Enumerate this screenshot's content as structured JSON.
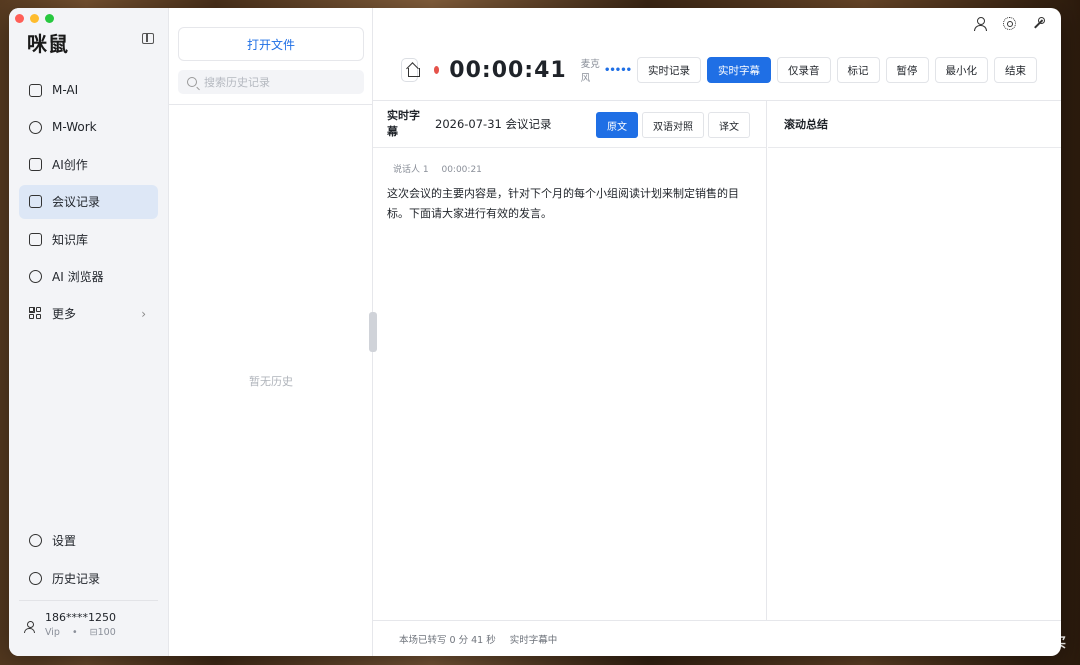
{
  "app": {
    "logo": "咪鼠"
  },
  "sidebar": {
    "items": [
      {
        "label": "M-AI",
        "icon": "chat-sparkle-icon"
      },
      {
        "label": "M-Work",
        "icon": "leaf-icon"
      },
      {
        "label": "AI创作",
        "icon": "image-icon"
      },
      {
        "label": "会议记录",
        "icon": "edit-note-icon",
        "active": true
      },
      {
        "label": "知识库",
        "icon": "book-icon"
      },
      {
        "label": "AI 浏览器",
        "icon": "compass-icon"
      },
      {
        "label": "更多",
        "icon": "grid-icon",
        "chevron": "›"
      }
    ],
    "bottom_items": [
      {
        "label": "设置",
        "icon": "gear-icon"
      },
      {
        "label": "历史记录",
        "icon": "clock-icon"
      }
    ],
    "user": {
      "phone": "186****1250",
      "tier": "Vip",
      "separator": "•",
      "credits": "⊟100"
    }
  },
  "history": {
    "open_file_label": "打开文件",
    "search_placeholder": "搜索历史记录",
    "empty_text": "暂无历史"
  },
  "toolbar": {
    "timer": "00:00:41",
    "mic_label": "麦克风",
    "mic_level": "•••••",
    "buttons": [
      {
        "label": "实时记录",
        "primary": false
      },
      {
        "label": "实时字幕",
        "primary": true
      },
      {
        "label": "仅录音",
        "primary": false
      },
      {
        "label": "标记",
        "primary": false
      },
      {
        "label": "暂停",
        "primary": false
      },
      {
        "label": "最小化",
        "primary": false
      },
      {
        "label": "结束",
        "primary": false
      }
    ]
  },
  "transcript_pane": {
    "label": "实时字幕",
    "meeting_title": "2026-07-31 会议记录",
    "tabs": [
      {
        "label": "原文",
        "active": true
      },
      {
        "label": "双语对照",
        "active": false
      },
      {
        "label": "译文",
        "active": false
      }
    ],
    "entries": [
      {
        "speaker": "说话人 1",
        "time": "00:00:21",
        "text": "这次会议的主要内容是，针对下个月的每个小组阅读计划来制定销售的目标。下面请大家进行有效的发言。"
      }
    ]
  },
  "summary_pane": {
    "label": "滚动总结"
  },
  "status_bar": {
    "transcribed": "本场已转写 0 分 41 秒",
    "state": "实时字幕中"
  },
  "watermark": "值 什么值得买",
  "colors": {
    "accent": "#1f6fe5",
    "record_dot": "#e5534b",
    "active_nav_bg": "#dde7f6"
  }
}
